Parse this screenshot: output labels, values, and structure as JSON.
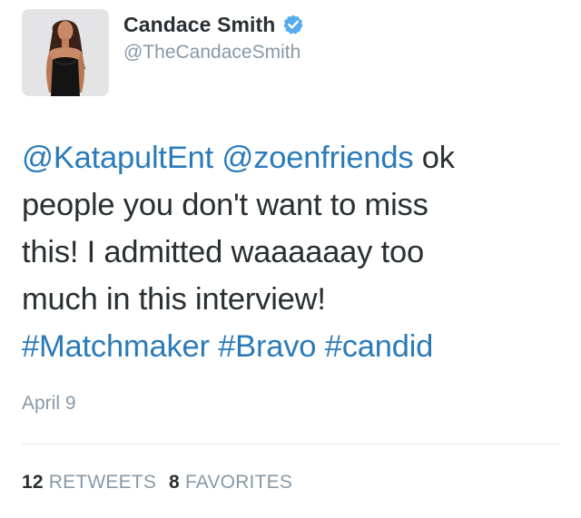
{
  "user": {
    "display_name": "Candace Smith",
    "handle": "@TheCandaceSmith",
    "verified": true
  },
  "tweet": {
    "mention_1": "@KatapultEnt",
    "mention_2": "@zoenfriends",
    "line1_text": " ok",
    "line2": "people you don't want to miss",
    "line3": "this! I admitted waaaaaay too",
    "line4": "much in this interview!",
    "hashtag_1": "#Matchmaker",
    "hashtag_2": "#Bravo",
    "hashtag_3": "#candid",
    "date": "April 9"
  },
  "stats": {
    "retweets_count": "12",
    "retweets_label": "RETWEETS",
    "favorites_count": "8",
    "favorites_label": "FAVORITES"
  },
  "colors": {
    "link": "#2b7bb9",
    "text": "#292f33",
    "muted": "#8899a6",
    "verified_badge": "#55acee"
  },
  "icons": {
    "verified": "verified-badge-icon",
    "avatar": "profile-photo"
  }
}
